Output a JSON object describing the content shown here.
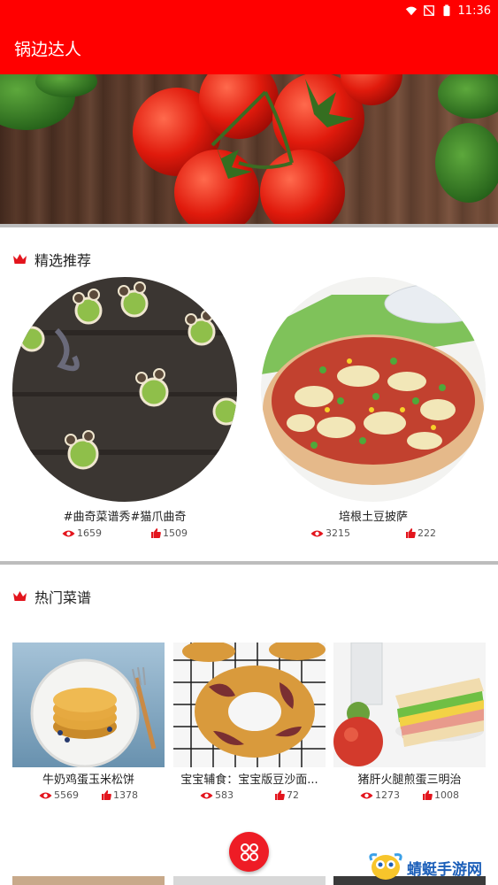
{
  "status_bar": {
    "time": "11:36"
  },
  "app_bar": {
    "title": "锅边达人"
  },
  "featured": {
    "title": "精选推荐",
    "items": [
      {
        "title": "#曲奇菜谱秀#猫爪曲奇",
        "views": "1659",
        "likes": "1509"
      },
      {
        "title": "培根土豆披萨",
        "views": "3215",
        "likes": "222"
      }
    ]
  },
  "popular": {
    "title": "热门菜谱",
    "items": [
      {
        "title": "牛奶鸡蛋玉米松饼",
        "views": "5569",
        "likes": "1378"
      },
      {
        "title": "宝宝辅食：宝宝版豆沙面...",
        "views": "583",
        "likes": "72"
      },
      {
        "title": "猪肝火腿煎蛋三明治",
        "views": "1273",
        "likes": "1008"
      }
    ]
  },
  "watermark": {
    "text": "蜻蜓手游网"
  },
  "colors": {
    "accent": "#ff0000",
    "fab": "#ee1c25",
    "icon_red": "#e3151d"
  },
  "icons": {
    "status": [
      "wifi-icon",
      "signal-off-icon",
      "battery-icon"
    ],
    "section": "crown-icon",
    "views": "eye-icon",
    "likes": "thumb-up-icon",
    "fab": "grid-menu-icon"
  }
}
